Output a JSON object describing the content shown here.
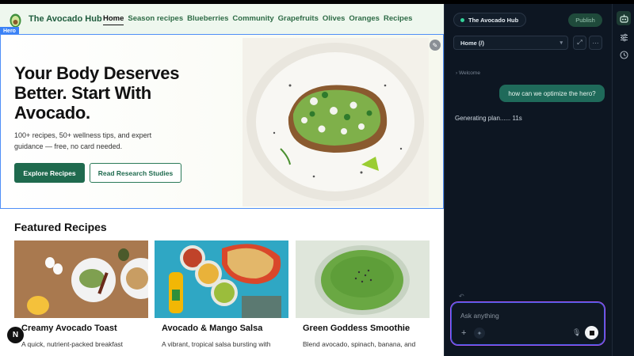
{
  "site": {
    "brand": "The Avocado Hub",
    "nav": [
      "Home",
      "Season recipes",
      "Blueberries",
      "Community",
      "Grapefruits",
      "Olives",
      "Oranges",
      "Recipes"
    ],
    "hero_tag": "Hero",
    "hero": {
      "headline": "Your Body Deserves Better. Start With Avocado.",
      "subtext": "100+ recipes, 50+ wellness tips, and expert guidance — free, no card needed.",
      "primary_button": "Explore Recipes",
      "secondary_button": "Read Research Studies"
    },
    "featured_heading": "Featured Recipes",
    "cards": [
      {
        "title": "Creamy Avocado Toast",
        "desc": "A quick, nutrient-packed breakfast"
      },
      {
        "title": "Avocado & Mango Salsa",
        "desc": "A vibrant, tropical salsa bursting with"
      },
      {
        "title": "Green Goddess Smoothie",
        "desc": "Blend avocado, spinach, banana, and"
      }
    ],
    "badge": "N"
  },
  "panel": {
    "project": "The Avocado Hub",
    "publish": "Publish",
    "route": "Home (/)",
    "welcome": "Welcome",
    "user_message": "how can we optimize the hero?",
    "status": "Generating plan...... 11s",
    "input_placeholder": "Ask anything"
  },
  "colors": {
    "brand_green": "#1f6a4e",
    "selection_blue": "#4f8ff7",
    "panel_bg": "#0d1622",
    "input_glow": "#a855f7"
  }
}
